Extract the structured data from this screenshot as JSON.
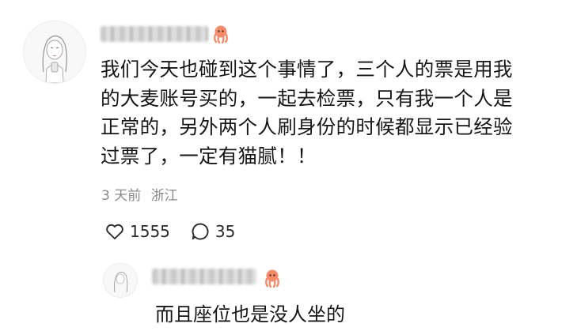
{
  "comment": {
    "text_lines": [
      "我们今天也碰到这个事情了，三个人的票是用我",
      "的大麦账号买的，一起去检票，只有我一个人是",
      "正常的，另外两个人刷身份的时候都显示已经验",
      "过票了，一定有猫腻！！"
    ],
    "time": "3 天前",
    "location": "浙江",
    "likes": "1555",
    "replies": "35",
    "like_icon": "heart-outline-icon",
    "reply_icon": "speech-bubble-icon",
    "badge_icon": "octopus-badge-icon"
  },
  "reply": {
    "text": "而且座位也是没人坐的"
  }
}
